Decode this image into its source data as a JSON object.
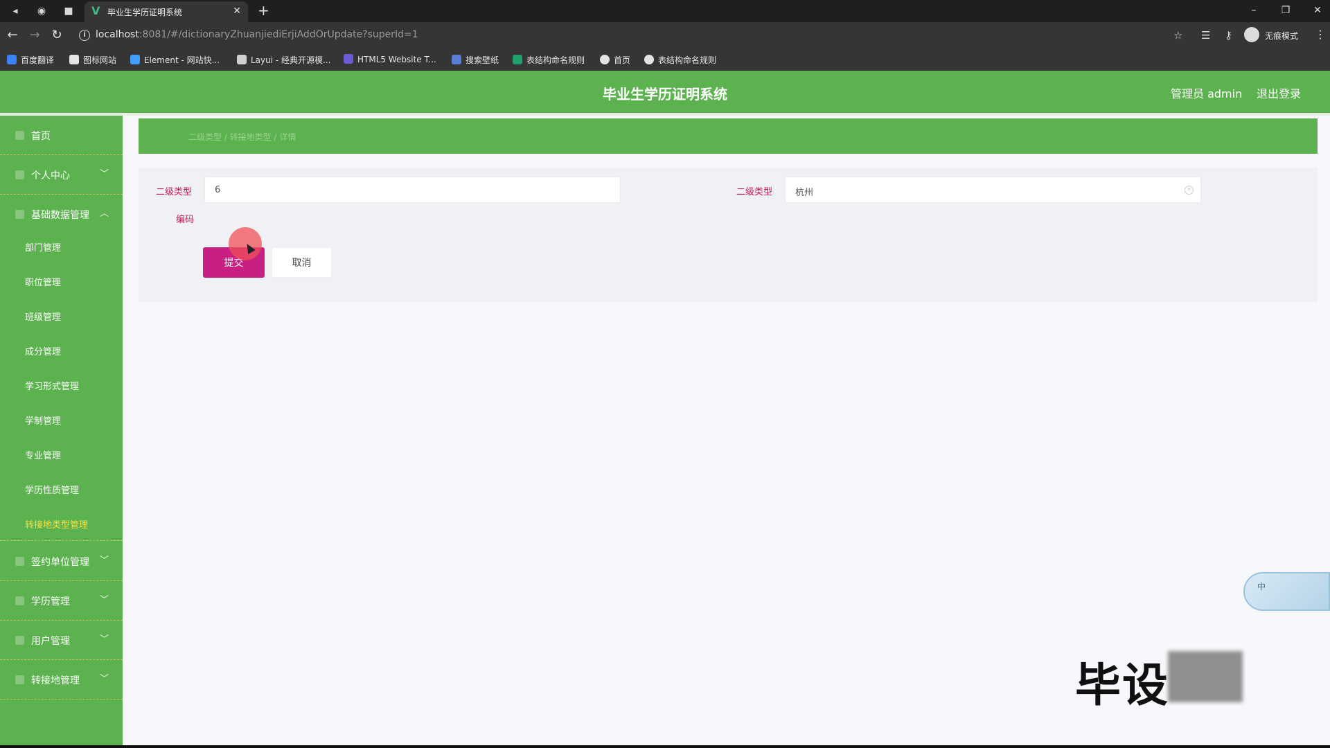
{
  "browser": {
    "tab_title": "毕业生学历证明系统",
    "url_host": "localhost",
    "url_rest": ":8081/#/dictionaryZhuanjiediErjiAddOrUpdate?superId=1",
    "incognito_label": "无痕模式",
    "bookmarks": [
      {
        "label": "百度翻译",
        "color": "#3b82f6"
      },
      {
        "label": "图标网站",
        "color": "#e5e5e5"
      },
      {
        "label": "Element - 网站快...",
        "color": "#409eff"
      },
      {
        "label": "Layui - 经典开源模...",
        "color": "#d0d0d0"
      },
      {
        "label": "HTML5 Website T...",
        "color": "#6b5bd6"
      },
      {
        "label": "搜索壁纸",
        "color": "#5b7fd6"
      },
      {
        "label": "表结构命名规则",
        "color": "#22a06b"
      },
      {
        "label": "首页",
        "color": "#e5e5e5"
      },
      {
        "label": "表结构命名规则",
        "color": "#e5e5e5"
      }
    ]
  },
  "header": {
    "title": "毕业生学历证明系统",
    "admin_label": "管理员 admin",
    "logout_label": "退出登录"
  },
  "sidebar": {
    "items": [
      {
        "label": "首页"
      },
      {
        "label": "个人中心",
        "chevron": "﹀"
      },
      {
        "label": "基础数据管理",
        "chevron": "︿"
      },
      {
        "label": "签约单位管理",
        "chevron": "﹀"
      },
      {
        "label": "学历管理",
        "chevron": "﹀"
      },
      {
        "label": "用户管理",
        "chevron": "﹀"
      },
      {
        "label": "转接地管理",
        "chevron": "﹀"
      }
    ],
    "subitems": [
      {
        "label": "部门管理"
      },
      {
        "label": "职位管理"
      },
      {
        "label": "班级管理"
      },
      {
        "label": "成分管理"
      },
      {
        "label": "学习形式管理"
      },
      {
        "label": "学制管理"
      },
      {
        "label": "专业管理"
      },
      {
        "label": "学历性质管理"
      },
      {
        "label": "转接地类型管理"
      }
    ]
  },
  "main": {
    "breadcrumb": "二级类型 / 转接地类型 / 详情",
    "form": {
      "code_label": "二级类型",
      "code_label_line2": "编码",
      "code_value": "6",
      "type_label": "二级类型",
      "type_value": "杭州",
      "submit_label": "提交",
      "cancel_label": "取消"
    }
  },
  "overlay": {
    "ime_label": "中",
    "watermark": "毕设"
  },
  "colors": {
    "primary_green": "#5cb24f",
    "submit_magenta": "#c81f83",
    "label_magenta": "#c2185b"
  }
}
